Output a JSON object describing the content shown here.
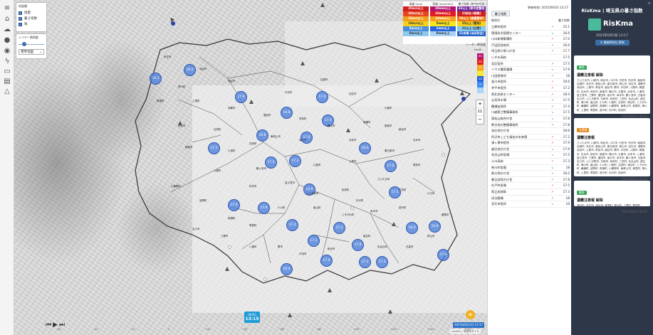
{
  "layers": {
    "header": "地図種",
    "items": [
      {
        "label": "雨量",
        "checked": true
      },
      {
        "label": "暑さ指数",
        "checked": true
      },
      {
        "label": "風",
        "checked": true
      }
    ],
    "opacity_label": "レイヤー透明度",
    "opacity_value": 0.15,
    "basemap_label": "標準地図"
  },
  "legend": {
    "columns": [
      {
        "header": "風速 (m/s)",
        "items": [
          {
            "label": "25m/s以上",
            "color": "#d21e1e"
          },
          {
            "label": "20m/s以上",
            "color": "#e5471e"
          },
          {
            "label": "15m/s以上",
            "color": "#f0a01e"
          },
          {
            "label": "10m/s以上",
            "color": "#f5d21e"
          },
          {
            "label": "5m/s以上",
            "color": "#4a8fd8"
          },
          {
            "label": "0m/s以上",
            "color": "#8cc8f0"
          }
        ]
      },
      {
        "header": "雨量 (mm/10m)",
        "items": [
          {
            "label": "30mm以上",
            "color": "#b4146e"
          },
          {
            "label": "20mm以上",
            "color": "#e11e1e"
          },
          {
            "label": "10mm以上",
            "color": "#f5a01e"
          },
          {
            "label": "5mm以上",
            "color": "#f5e61e"
          },
          {
            "label": "1mm以上",
            "color": "#2864dc"
          },
          {
            "label": "0mm以上",
            "color": "#aad2f5"
          }
        ]
      },
      {
        "header": "暑さ指数 (熱中症危険度)",
        "items": [
          {
            "label": "33以上 (熱中症警戒アラート)",
            "color": "#6e1e96"
          },
          {
            "label": "31以上 (危険)",
            "color": "#d21e1e"
          },
          {
            "label": "28以上 (厳重警戒)",
            "color": "#f07814"
          },
          {
            "label": "25以上 (警戒)",
            "color": "#f5d21e"
          },
          {
            "label": "21以上 (注意)",
            "color": "#82c8f0"
          },
          {
            "label": "21未満 (ほぼ安全)",
            "color": "#2864c8"
          }
        ]
      }
    ],
    "footer": "レーダー降雨量",
    "scale_label": "mm/h",
    "scale": [
      {
        "label": "80",
        "color": "#b4146e"
      },
      {
        "label": "50",
        "color": "#e11e1e"
      },
      {
        "label": "30",
        "color": "#f5a01e"
      },
      {
        "label": "20",
        "color": "#f5e61e"
      },
      {
        "label": "10",
        "color": "#2864dc"
      },
      {
        "label": "5",
        "color": "#3c8cf0"
      },
      {
        "label": "1",
        "color": "#aad2f5"
      }
    ]
  },
  "zoom": {
    "plus": "+",
    "level": "11",
    "minus": "−"
  },
  "stations": [
    {
      "v": "16.3"
    },
    {
      "v": "16.0"
    },
    {
      "v": "17.6"
    },
    {
      "v": "16.8"
    },
    {
      "v": "17.0"
    },
    {
      "v": "17.4"
    },
    {
      "v": "17.6"
    },
    {
      "v": "16.6"
    },
    {
      "v": "17.1"
    },
    {
      "v": "17.5"
    },
    {
      "v": "17.3"
    },
    {
      "v": "16.0"
    },
    {
      "v": "17.6"
    },
    {
      "v": "17.5"
    },
    {
      "v": "16.8"
    },
    {
      "v": "17.4"
    },
    {
      "v": "17.6"
    },
    {
      "v": "17.4"
    },
    {
      "v": "17.1"
    },
    {
      "v": "17.8"
    },
    {
      "v": "17.3"
    },
    {
      "v": "17.3"
    },
    {
      "v": "16.4"
    },
    {
      "v": "17.0"
    },
    {
      "v": "17.2"
    },
    {
      "v": "16.0"
    },
    {
      "v": "16.8"
    },
    {
      "v": "17.6"
    }
  ],
  "places": [
    "本庄市",
    "深谷市",
    "熊谷市",
    "行田市",
    "加須市",
    "羽生市",
    "久喜市",
    "鴻巣市",
    "東松山市",
    "坂戸市",
    "川越市",
    "上尾市",
    "さいたま市",
    "春日部市",
    "越谷市",
    "草加市",
    "川口市",
    "所沢市",
    "入間市",
    "飯能市",
    "秩父市",
    "小鹿野町",
    "皆野町",
    "長瀞町",
    "寄居町",
    "小川町",
    "嵐山町",
    "ときがわ町",
    "越生町",
    "毛呂山町",
    "日高市",
    "狭山市",
    "朝霞市",
    "和光市",
    "戸田市",
    "蕨市",
    "八潮市",
    "三郷市",
    "吉川市",
    "松伏町",
    "杉戸町",
    "幸手市",
    "宮代町",
    "白岡市",
    "蓮田市",
    "伊奈町",
    "桶川市",
    "北本市",
    "吉見町",
    "川島町",
    "鶴ヶ島市",
    "富士見市",
    "ふじみ野市",
    "三芳町",
    "志木市",
    "新座市",
    "清瀬市",
    "美里町",
    "神川町",
    "上里町"
  ],
  "timeline": {
    "date": "06/03",
    "time": "13:15",
    "datetime_button": "2025年6月3日 13:17",
    "ticks": [
      "-6h",
      "-4h",
      "-2h",
      "0",
      "+2h",
      "+4h",
      "+6h",
      "+8h",
      "+10h",
      "+12h",
      "+14h",
      "+16h"
    ]
  },
  "attribution": "Leaflet | 地理院タイル",
  "ranking": {
    "updated_label": "更新時刻",
    "updated_value": "2025/06/03 13:17",
    "button": "暑さ指数",
    "col_station": "観測所",
    "col_value": "暑さ指数",
    "rows": [
      {
        "name": "三郷市役所",
        "trend": "↗",
        "value": "15.1"
      },
      {
        "name": "環境科学国際センター",
        "trend": "↘",
        "value": "16.6"
      },
      {
        "name": "川口新郷集積所",
        "trend": "↗",
        "value": "17.0"
      },
      {
        "name": "戸田西保育所",
        "trend": "↗",
        "value": "16.6"
      },
      {
        "name": "埼玉県庁第二庁舎",
        "trend": "↗",
        "value": "17.7"
      },
      {
        "name": "いずみ高校",
        "trend": "",
        "value": "17.5"
      },
      {
        "name": "北区役所",
        "trend": "↗",
        "value": "17.5"
      },
      {
        "name": "ハウス農家圃場",
        "trend": "↘",
        "value": "17.9"
      },
      {
        "name": "川田保育所",
        "trend": "↗",
        "value": "18"
      },
      {
        "name": "並川市役所",
        "trend": "↗",
        "value": "18.6"
      },
      {
        "name": "幸手市役所",
        "trend": "↗",
        "value": "17.2"
      },
      {
        "name": "県北技術センター",
        "trend": "↗",
        "value": "18.4"
      },
      {
        "name": "吉見浄水場",
        "trend": "↗",
        "value": "17.5"
      },
      {
        "name": "鶴瀬出張所",
        "trend": "↗",
        "value": "17.4"
      },
      {
        "name": "川越第三整備事務所",
        "trend": "↘",
        "value": "17.5"
      },
      {
        "name": "東松山総合庁舎",
        "trend": "↘",
        "value": "17.8"
      },
      {
        "name": "熊谷地方整備事務所",
        "trend": "↗",
        "value": "17.8"
      },
      {
        "name": "本庄地方庁舎",
        "trend": "-",
        "value": "18.6"
      },
      {
        "name": "所沢市こども福祉の未来園",
        "trend": "↗",
        "value": "17.2"
      },
      {
        "name": "鴻ヶ巣市役所",
        "trend": "↗",
        "value": "17.9"
      },
      {
        "name": "越谷地方庁舎",
        "trend": "↘",
        "value": "17.9"
      },
      {
        "name": "毛呂山町役場",
        "trend": "↘",
        "value": "17.5"
      },
      {
        "name": "小川高校",
        "trend": "↗",
        "value": "17.3"
      },
      {
        "name": "神川町役場",
        "trend": "↘",
        "value": "18"
      },
      {
        "name": "秩父地方庁舎",
        "trend": "↗",
        "value": "18.2"
      },
      {
        "name": "春日部地方庁舎",
        "trend": "↗",
        "value": "17.8"
      },
      {
        "name": "杉戸町役場",
        "trend": "↗",
        "value": "17.5"
      },
      {
        "name": "県立加須高",
        "trend": "↗",
        "value": "17.3"
      },
      {
        "name": "深谷圃場",
        "trend": "↗",
        "value": "18"
      },
      {
        "name": "羽生市役所",
        "trend": "↘",
        "value": "16"
      }
    ]
  },
  "panel": {
    "title": "RisKma | 埼玉県の暑さ指数",
    "close": "×",
    "logo_text": "RisKma",
    "date": "2025年6月3日 13:17",
    "update_button": "最新時刻に更新",
    "cards": [
      {
        "badge": "解除",
        "badge_color": "#3aa65a",
        "heading": "濃霧注意報 解除",
        "body": "さいたま市, 川越市, 熊谷市, 川口市, 行田市, 所沢市, 飯能市, 加須市, 本庄市, 東松山市, 春日部市, 狭山市, 羽生市, 鴻巣市, 深谷市, 上尾市, 草加市, 越谷市, 蕨市, 戸田市, 入間市, 朝霞市, 志木市, 和光市, 新座市, 桶川市, 久喜市, 北本市, 八潮市, 富士見市, 三郷市, 蓮田市, 坂戸市, 幸手市, 鶴ヶ島市, 日高市, 吉川市, ふじみ野市, 白岡市, 伊奈町, 三芳町, 毛呂山町, 越生町, 滑川町, 嵐山町, 小川町, 川島町, 吉見町, 鳩山町, ときがわ町, 横瀬町, 皆野町, 長瀞町, 小鹿野町, 東秩父村, 美里町, 神川町, 上里町, 寄居町, 宮代町, 杉戸町, 松伏町",
        "time": "2025/06/02 08:33"
      },
      {
        "badge": "注意報",
        "badge_color": "#e08a1e",
        "heading": "濃霧注意報",
        "body": "さいたま市, 川越市, 熊谷市, 川口市, 行田市, 所沢市, 飯能市, 加須市, 本庄市, 東松山市, 春日部市, 狭山市, 羽生市, 鴻巣市, 深谷市, 上尾市, 草加市, 越谷市, 蕨市, 戸田市, 入間市, 朝霞市, 志木市, 和光市, 新座市, 桶川市, 久喜市, 北本市, 八潮市, 富士見市, 三郷市, 蓮田市, 坂戸市, 幸手市, 鶴ヶ島市, 日高市, 吉川市, ふじみ野市, 白岡市, 伊奈町, 三芳町, 毛呂山町, 越生町, 滑川町, 嵐山町, 小川町, 川島町, 吉見町, 鳩山町, ときがわ町, 横瀬町, 皆野町, 長瀞町, 小鹿野町, 東秩父村, 美里町, 神川町, 上里町, 寄居町, 宮代町, 杉戸町, 松伏町",
        "time": "2025/06/02 03:32"
      },
      {
        "badge": "解除",
        "badge_color": "#3aa65a",
        "heading": "濃霧注意報 解除",
        "body": "熊谷市, 本庄市, 深谷市, 美里町, 神川町, 上里町, 寄居町",
        "time": "2025/06/01 08:06"
      }
    ]
  }
}
